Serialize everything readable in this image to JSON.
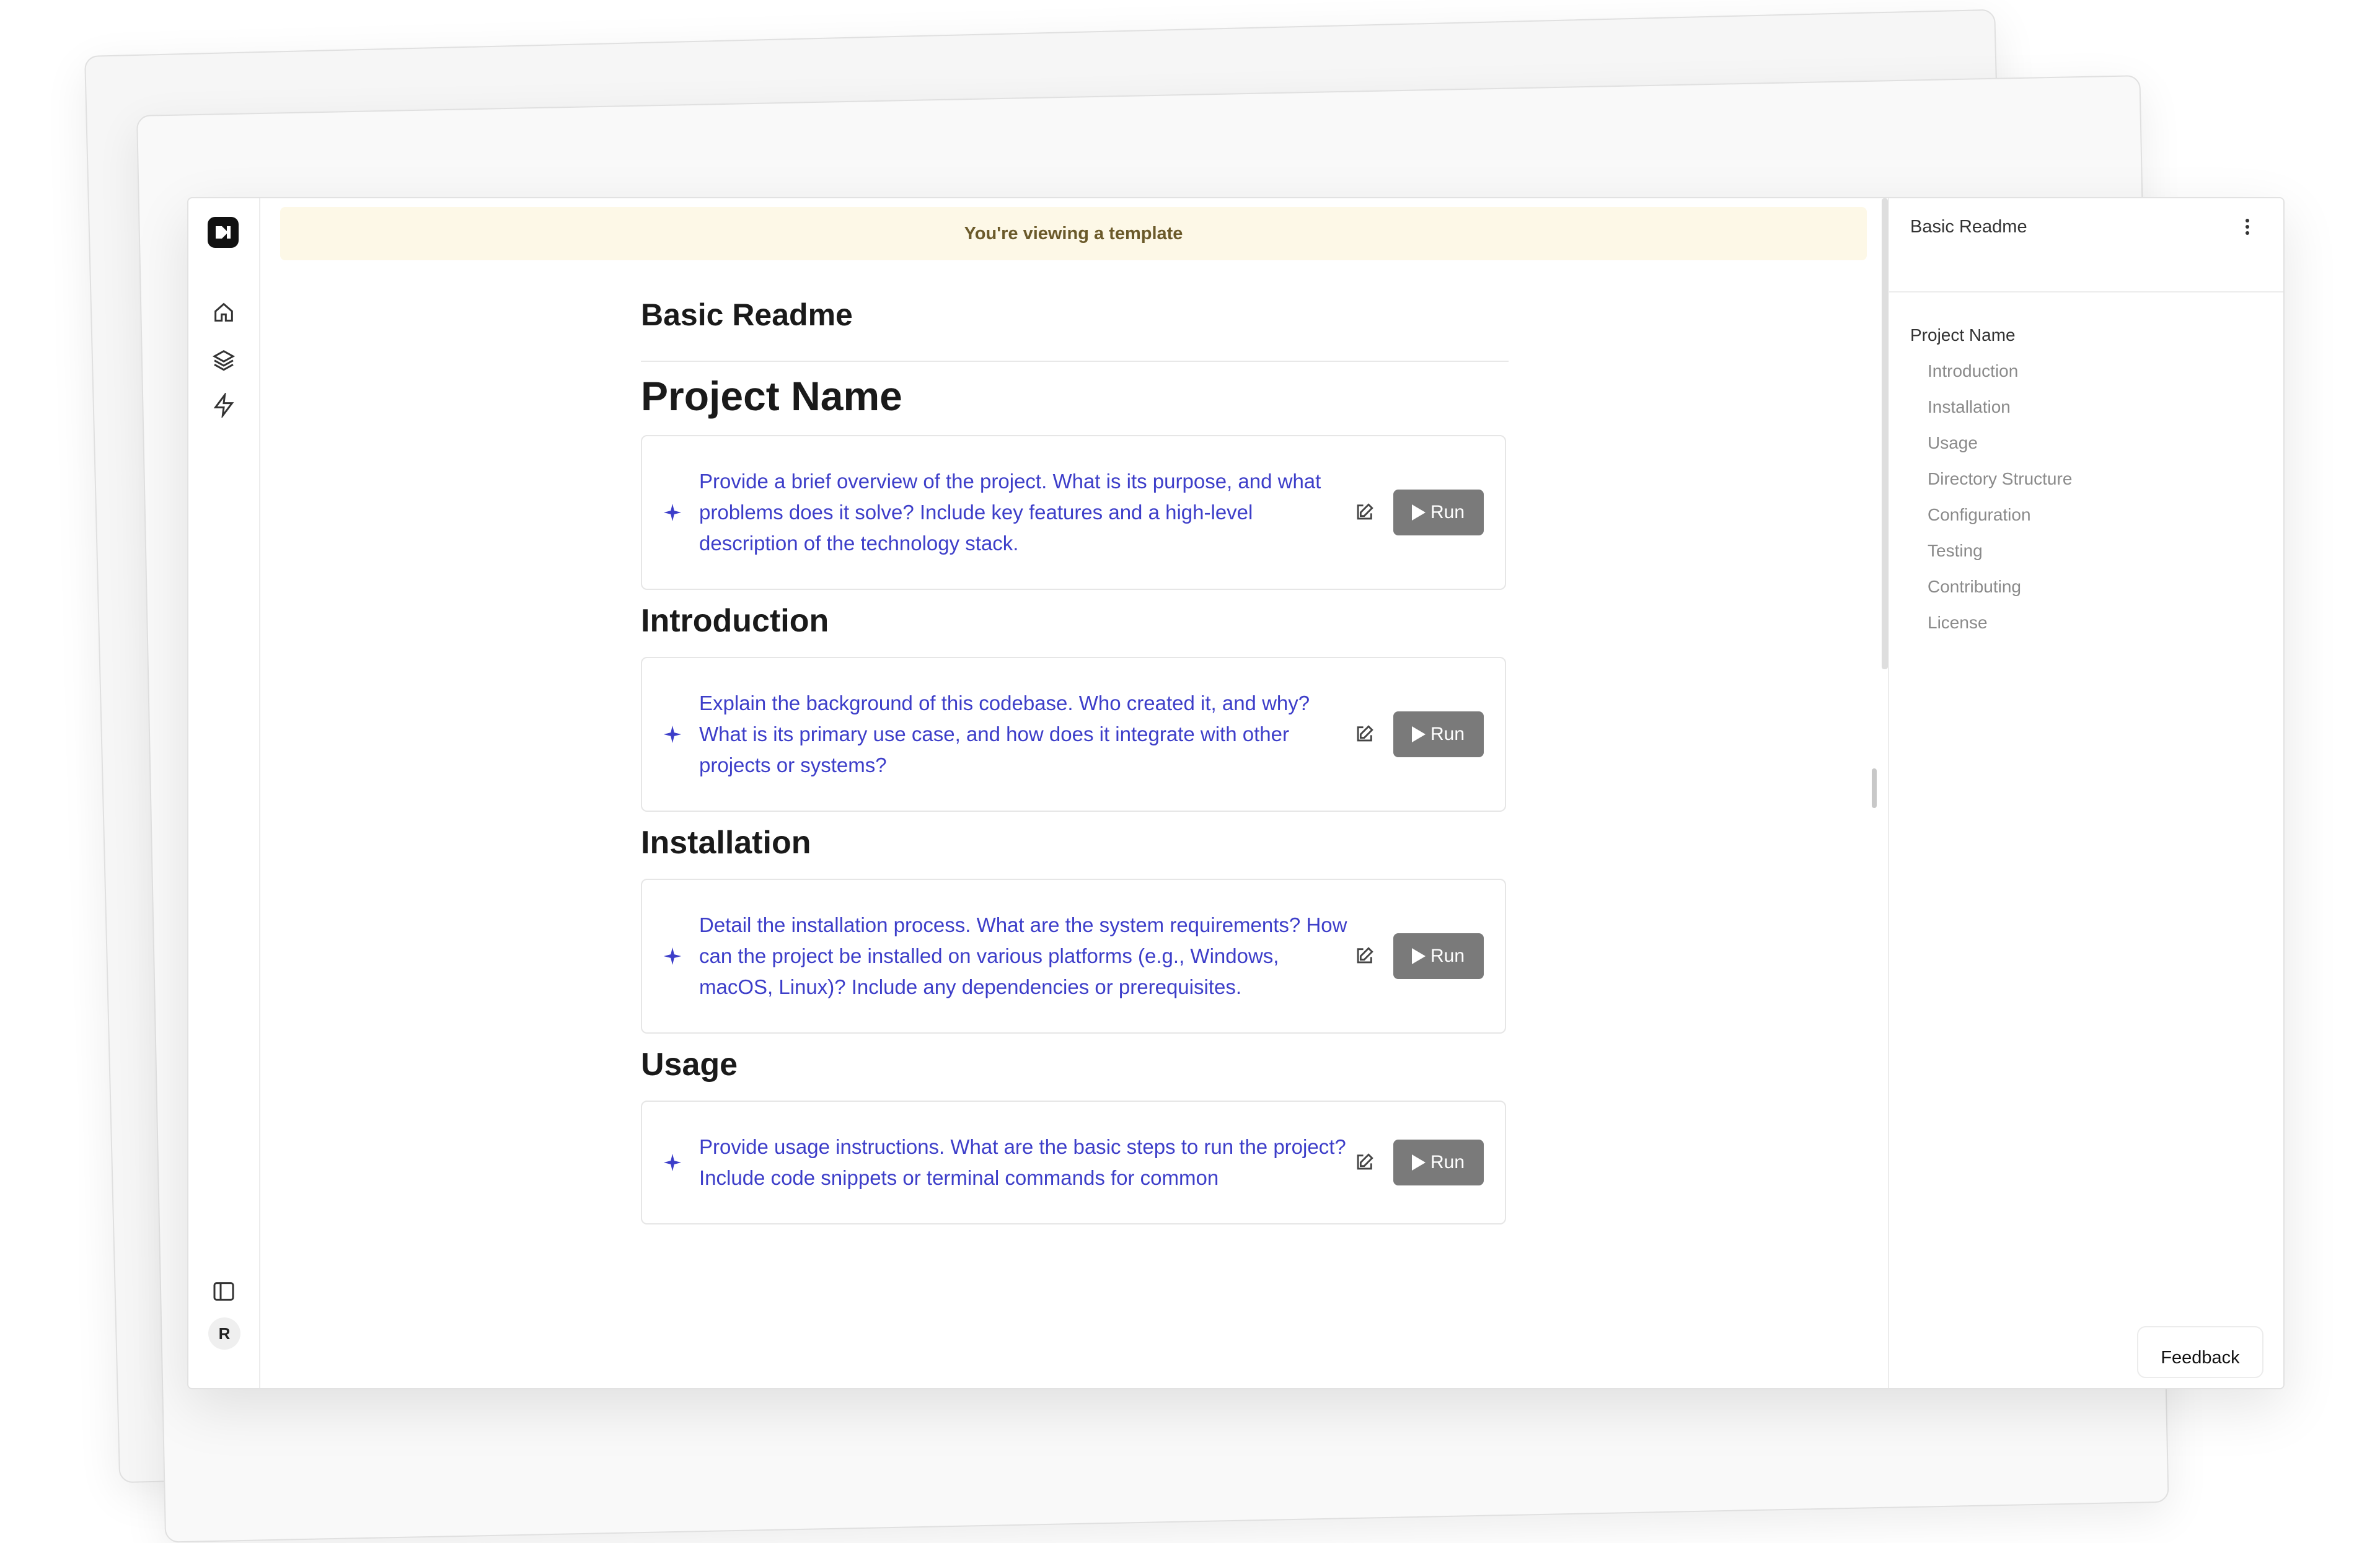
{
  "banner": "You're viewing a template",
  "doc": {
    "title": "Basic Readme",
    "sections": [
      {
        "heading": "Project Name",
        "prompt": "Provide a brief overview of the project. What is its purpose, and what problems does it solve? Include key features and a high-level description of the technology stack."
      },
      {
        "heading": "Introduction",
        "prompt": "Explain the background of this codebase. Who created it, and why? What is its primary use case, and how does it integrate with other projects or systems?"
      },
      {
        "heading": "Installation",
        "prompt": "Detail the installation process. What are the system requirements? How can the project be installed on various platforms (e.g., Windows, macOS, Linux)? Include any dependencies or prerequisites."
      },
      {
        "heading": "Usage",
        "prompt": "Provide usage instructions. What are the basic steps to run the project? Include code snippets or terminal commands for common"
      }
    ],
    "run_label": "Run"
  },
  "toc": {
    "title": "Basic Readme",
    "items": [
      "Project Name",
      "Introduction",
      "Installation",
      "Usage",
      "Directory Structure",
      "Configuration",
      "Testing",
      "Contributing",
      "License"
    ]
  },
  "rail": {
    "avatar": "R",
    "icons": [
      "logo-icon",
      "home-icon",
      "layers-icon",
      "lightning-icon",
      "sidebar-toggle-icon"
    ]
  },
  "feedback": "Feedback",
  "colors": {
    "prompt": "#3d3ec9",
    "banner_bg": "#fdf8e7",
    "banner_text": "#6b5a2a",
    "run_bg": "#7a7a7a"
  }
}
